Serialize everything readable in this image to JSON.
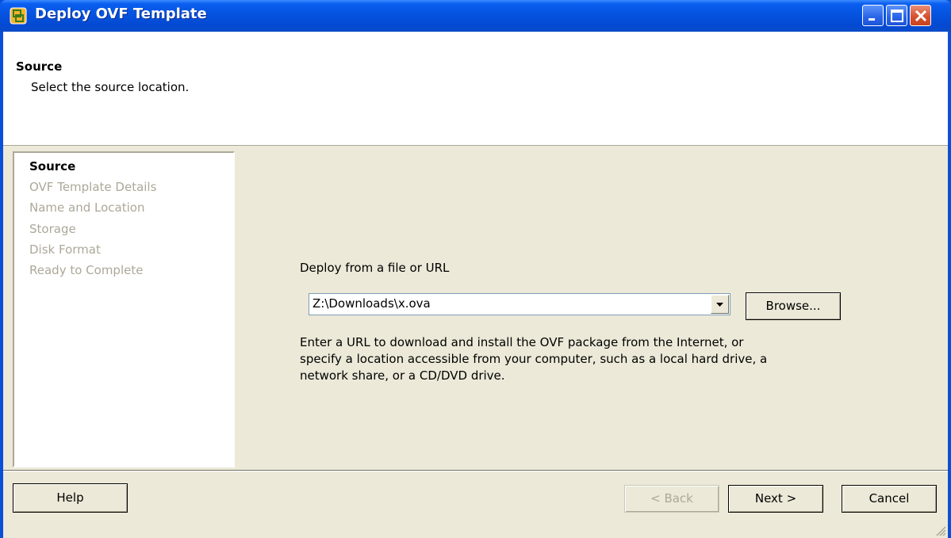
{
  "window": {
    "title": "Deploy OVF Template"
  },
  "header": {
    "title": "Source",
    "subtitle": "Select the source location."
  },
  "steps": [
    {
      "label": "Source",
      "active": true
    },
    {
      "label": "OVF Template Details",
      "active": false
    },
    {
      "label": "Name and Location",
      "active": false
    },
    {
      "label": "Storage",
      "active": false
    },
    {
      "label": "Disk Format",
      "active": false
    },
    {
      "label": "Ready to Complete",
      "active": false
    }
  ],
  "content": {
    "deploy_label": "Deploy from a file or URL",
    "source_value": "Z:\\Downloads\\x.ova",
    "browse_label": "Browse...",
    "description_lines": [
      "Enter a URL to download and install the OVF package from the Internet, or",
      "specify a location accessible from your computer, such as a local hard drive, a",
      "network share, or a CD/DVD drive."
    ]
  },
  "buttons": {
    "help": "Help",
    "back": "< Back",
    "next": "Next >",
    "cancel": "Cancel"
  },
  "icons": {
    "app": "vsphere-deploy-icon",
    "minimize": "minimize-icon",
    "maximize": "maximize-icon",
    "close": "close-icon"
  }
}
